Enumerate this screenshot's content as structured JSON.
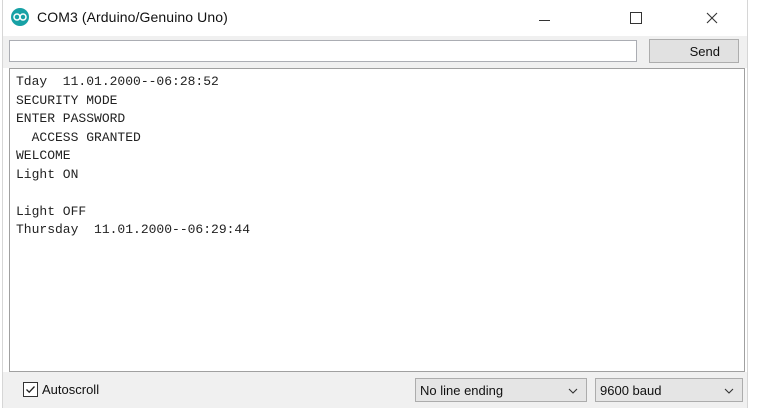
{
  "window": {
    "title": "COM3 (Arduino/Genuino Uno)"
  },
  "input": {
    "value": "",
    "send_label": "Send"
  },
  "console": {
    "lines": [
      "Tday  11.01.2000--06:28:52",
      "SECURITY MODE",
      "ENTER PASSWORD",
      "  ACCESS GRANTED",
      "WELCOME",
      "Light ON",
      "",
      "Light OFF",
      "Thursday  11.01.2000--06:29:44"
    ]
  },
  "footer": {
    "autoscroll_label": "Autoscroll",
    "autoscroll_checked": true,
    "line_ending": "No line ending",
    "baud": "9600 baud"
  },
  "colors": {
    "arduino_teal": "#17a1a5"
  },
  "icons": [
    "arduino-logo-icon",
    "minimize-icon",
    "maximize-icon",
    "close-icon",
    "checkbox-check-icon",
    "chevron-down-icon"
  ]
}
